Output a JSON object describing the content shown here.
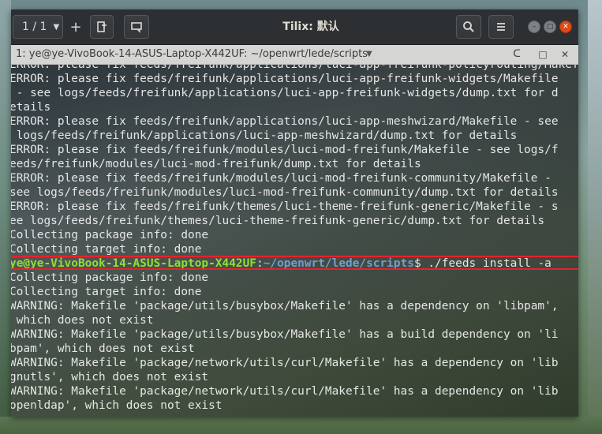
{
  "window": {
    "title": "Tilix: 默认",
    "session_label": "1 / 1",
    "add_label": "+"
  },
  "tab": {
    "title": "1: ye@ye-VivoBook-14-ASUS-Laptop-X442UF: ~/openwrt/lede/scripts"
  },
  "terminal": {
    "lines_before": [
      "ERROR: please fix feeds/freifunk/applications/luci-app-freifunk-policyrouting/Makefile - see logs/feeds/freifunk/applications/luci-app-freifunk-policyrouting/dump.txt for details",
      "ERROR: please fix feeds/freifunk/applications/luci-app-freifunk-widgets/Makefile",
      " - see logs/feeds/freifunk/applications/luci-app-freifunk-widgets/dump.txt for d",
      "etails",
      "ERROR: please fix feeds/freifunk/applications/luci-app-meshwizard/Makefile - see",
      " logs/feeds/freifunk/applications/luci-app-meshwizard/dump.txt for details",
      "ERROR: please fix feeds/freifunk/modules/luci-mod-freifunk/Makefile - see logs/f",
      "eeds/freifunk/modules/luci-mod-freifunk/dump.txt for details",
      "ERROR: please fix feeds/freifunk/modules/luci-mod-freifunk-community/Makefile -",
      "see logs/feeds/freifunk/modules/luci-mod-freifunk-community/dump.txt for details",
      "ERROR: please fix feeds/freifunk/themes/luci-theme-freifunk-generic/Makefile - s",
      "ee logs/feeds/freifunk/themes/luci-theme-freifunk-generic/dump.txt for details",
      "Collecting package info: done",
      "Collecting target info: done"
    ],
    "prompt": {
      "user_host": "ye@ye-VivoBook-14-ASUS-Laptop-X442UF",
      "sep": ":",
      "path": "~/openwrt/lede/scripts",
      "symbol": "$ ",
      "command": "./feeds install -a"
    },
    "lines_after": [
      "Collecting package info: done",
      "Collecting target info: done",
      "WARNING: Makefile 'package/utils/busybox/Makefile' has a dependency on 'libpam',",
      " which does not exist",
      "WARNING: Makefile 'package/utils/busybox/Makefile' has a build dependency on 'li",
      "bpam', which does not exist",
      "WARNING: Makefile 'package/network/utils/curl/Makefile' has a dependency on 'lib",
      "gnutls', which does not exist",
      "WARNING: Makefile 'package/network/utils/curl/Makefile' has a dependency on 'lib",
      "openldap', which does not exist"
    ]
  },
  "colors": {
    "prompt_user": "#8ae234",
    "prompt_path": "#729fcf",
    "highlight": "#e8212b",
    "close_button": "#df4a16"
  },
  "icons": {
    "session_dropdown": "chevron-down-icon",
    "add_terminal": "add-terminal-icon",
    "chat": "chat-icon",
    "search": "search-icon",
    "menu": "hamburger-menu-icon",
    "sync_input": "sync-input-icon",
    "maximize": "maximize-icon",
    "close": "close-icon"
  }
}
